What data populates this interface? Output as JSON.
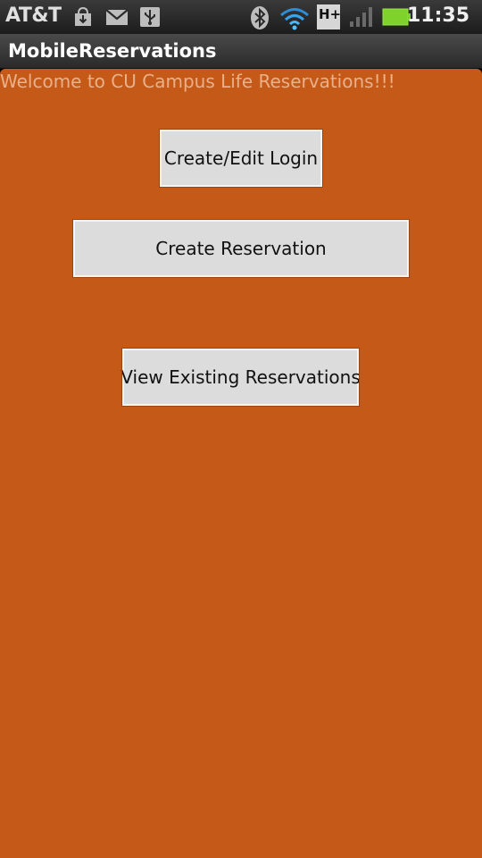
{
  "status_bar": {
    "carrier": "AT&T",
    "time": "11:35",
    "network_type": "H+",
    "icons": [
      "download-icon",
      "gmail-icon",
      "usb-icon",
      "bluetooth-icon",
      "wifi-icon",
      "network-type-icon",
      "signal-icon",
      "battery-icon"
    ]
  },
  "app": {
    "title": "MobileReservations"
  },
  "main": {
    "welcome_text": "Welcome to CU Campus Life Reservations!!!",
    "buttons": {
      "login": "Create/Edit Login",
      "create_reservation": "Create Reservation",
      "view_reservations": "View Existing Reservations"
    }
  },
  "colors": {
    "background": "#c55a18",
    "welcome_text": "#e9b08a",
    "button": "#dcdcdc"
  }
}
